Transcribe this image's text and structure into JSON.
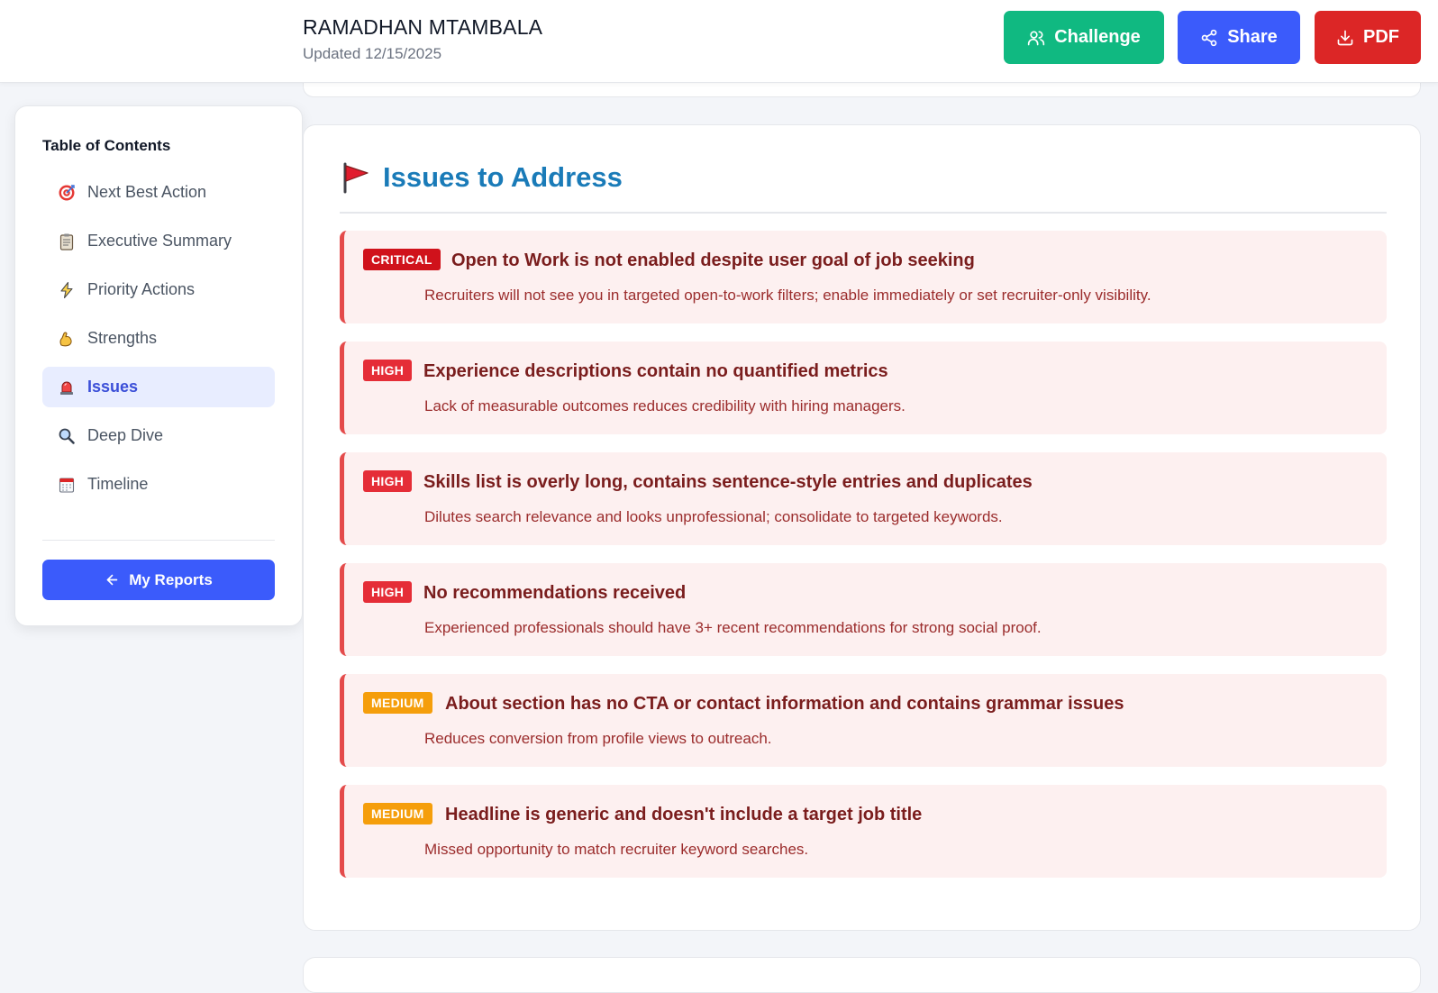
{
  "header": {
    "name": "RAMADHAN MTAMBALA",
    "updated": "Updated 12/15/2025",
    "challenge_label": "Challenge",
    "share_label": "Share",
    "pdf_label": "PDF"
  },
  "sidebar": {
    "title": "Table of Contents",
    "items": [
      {
        "label": "Next Best Action",
        "icon": "target-icon"
      },
      {
        "label": "Executive Summary",
        "icon": "clipboard-icon"
      },
      {
        "label": "Priority Actions",
        "icon": "lightning-icon"
      },
      {
        "label": "Strengths",
        "icon": "flexed-biceps-icon"
      },
      {
        "label": "Issues",
        "icon": "siren-icon",
        "active": true
      },
      {
        "label": "Deep Dive",
        "icon": "magnifier-icon"
      },
      {
        "label": "Timeline",
        "icon": "calendar-icon"
      }
    ],
    "my_reports_label": "My Reports"
  },
  "issues_section": {
    "title": "Issues to Address",
    "icon": "red-flag-icon",
    "issues": [
      {
        "severity": "CRITICAL",
        "title": "Open to Work is not enabled despite user goal of job seeking",
        "description": "Recruiters will not see you in targeted open-to-work filters; enable immediately or set recruiter-only visibility."
      },
      {
        "severity": "HIGH",
        "title": "Experience descriptions contain no quantified metrics",
        "description": "Lack of measurable outcomes reduces credibility with hiring managers."
      },
      {
        "severity": "HIGH",
        "title": "Skills list is overly long, contains sentence-style entries and duplicates",
        "description": "Dilutes search relevance and looks unprofessional; consolidate to targeted keywords."
      },
      {
        "severity": "HIGH",
        "title": "No recommendations received",
        "description": "Experienced professionals should have 3+ recent recommendations for strong social proof."
      },
      {
        "severity": "MEDIUM",
        "title": "About section has no CTA or contact information and contains grammar issues",
        "description": "Reduces conversion from profile views to outreach."
      },
      {
        "severity": "MEDIUM",
        "title": "Headline is generic and doesn't include a target job title",
        "description": "Missed opportunity to match recruiter keyword searches."
      }
    ]
  },
  "colors": {
    "challenge": "#10b981",
    "share": "#3b5bfb",
    "pdf": "#dc2626",
    "critical": "#d0121b",
    "high": "#e52d37",
    "medium": "#f59e0b",
    "section_title": "#1a7bb8"
  }
}
